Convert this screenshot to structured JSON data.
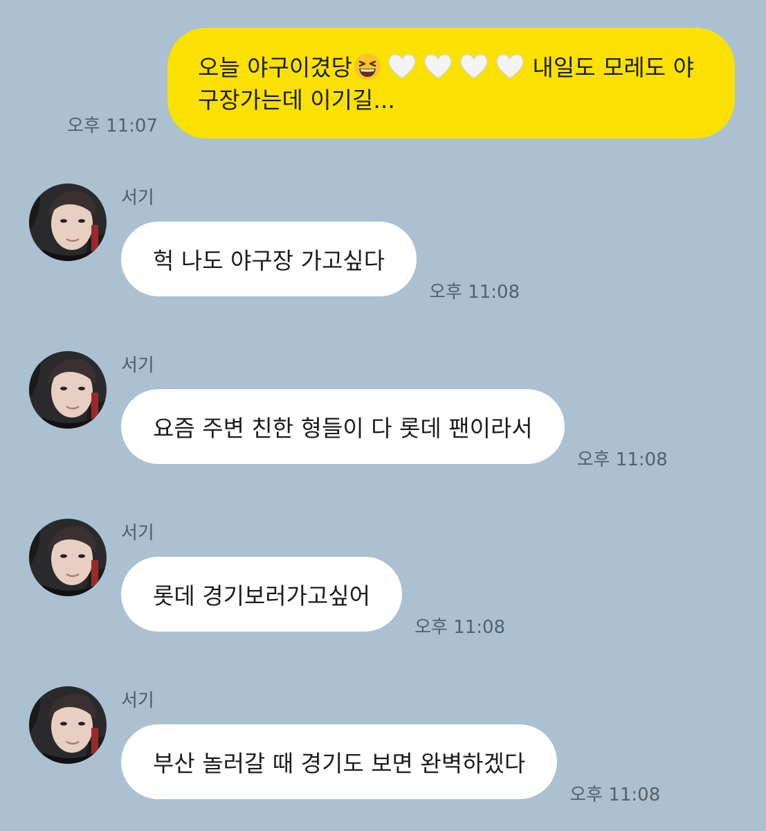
{
  "sent": {
    "text_before_emoji": "오늘 야구이겼당",
    "emoji": "grinning-squinting-face",
    "hearts": [
      "white-heart",
      "white-heart",
      "white-heart",
      "white-heart"
    ],
    "text_after_emoji": " 내일도 모레도 야구장가는데 이기길...",
    "time": "오후 11:07"
  },
  "received": [
    {
      "sender": "서기",
      "text": "헉 나도 야구장 가고싶다",
      "time": "오후 11:08"
    },
    {
      "sender": "서기",
      "text": "요즘 주변 친한 형들이 다 롯데 팬이라서",
      "time": "오후 11:08"
    },
    {
      "sender": "서기",
      "text": "롯데 경기보러가고싶어",
      "time": "오후 11:08"
    },
    {
      "sender": "서기",
      "text": "부산 놀러갈 때 경기도 보면 완벽하겠다",
      "time": "오후 11:08"
    }
  ],
  "colors": {
    "background": "#abc1d1",
    "sent_bubble": "#fae100",
    "received_bubble": "#ffffff"
  }
}
